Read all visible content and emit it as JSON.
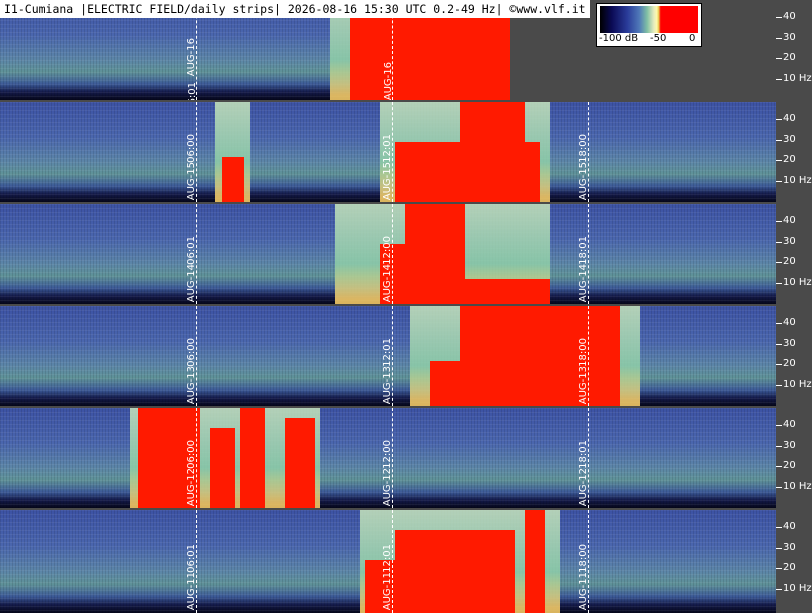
{
  "title": "I1-Cumiana |ELECTRIC FIELD/daily strips| 2026-08-16 15:30 UTC 0.2-49 Hz| ©www.vlf.it",
  "legend": {
    "min_label": "-100 dB",
    "mid_label": "-50",
    "max_label": "0"
  },
  "axis_labels": [
    "40",
    "30",
    "20",
    "10 Hz"
  ],
  "strips": [
    {
      "day": "AUG-16",
      "markers": [
        "06:01"
      ],
      "center_date": "AUG-16"
    },
    {
      "day": "AUG-15",
      "markers": [
        "06:00",
        "12:01",
        "18:00"
      ]
    },
    {
      "day": "AUG-14",
      "markers": [
        "06:01",
        "12:00",
        "18:01"
      ]
    },
    {
      "day": "AUG-13",
      "markers": [
        "06:00",
        "12:01",
        "18:00"
      ]
    },
    {
      "day": "AUG-12",
      "markers": [
        "06:00",
        "12:00",
        "18:01"
      ]
    },
    {
      "day": "AUG-11",
      "markers": [
        "06:01",
        "12:01",
        "18:00"
      ]
    }
  ]
}
